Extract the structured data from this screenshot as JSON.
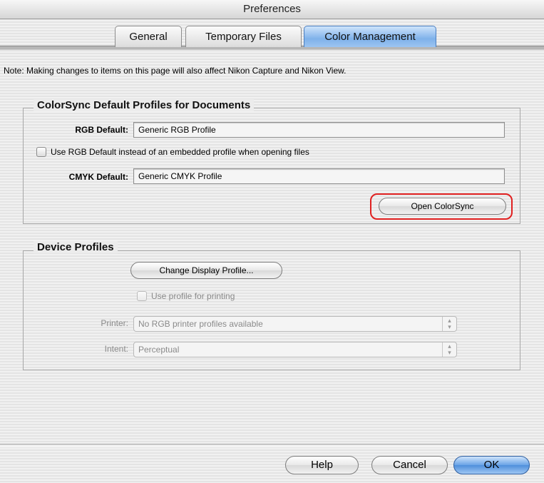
{
  "window": {
    "title": "Preferences"
  },
  "tabs": [
    {
      "label": "General"
    },
    {
      "label": "Temporary Files"
    },
    {
      "label": "Color Management",
      "active": true
    }
  ],
  "note": "Note: Making changes to items on this page will also affect Nikon Capture and Nikon View.",
  "colorsync": {
    "title": "ColorSync Default Profiles for Documents",
    "rgb_label": "RGB Default:",
    "rgb_value": "Generic RGB Profile",
    "use_rgb_checkbox_label": "Use RGB Default instead of an embedded profile when opening files",
    "use_rgb_checked": false,
    "cmyk_label": "CMYK Default:",
    "cmyk_value": "Generic CMYK Profile",
    "open_button": "Open ColorSync"
  },
  "device": {
    "title": "Device Profiles",
    "change_display_button": "Change Display Profile...",
    "use_for_printing_label": "Use profile for printing",
    "use_for_printing_checked": false,
    "printer_label": "Printer:",
    "printer_value": "No RGB printer profiles available",
    "intent_label": "Intent:",
    "intent_value": "Perceptual"
  },
  "footer": {
    "help": "Help",
    "cancel": "Cancel",
    "ok": "OK"
  },
  "colors": {
    "highlight": "#e02020",
    "accent": "#5b9be3"
  }
}
